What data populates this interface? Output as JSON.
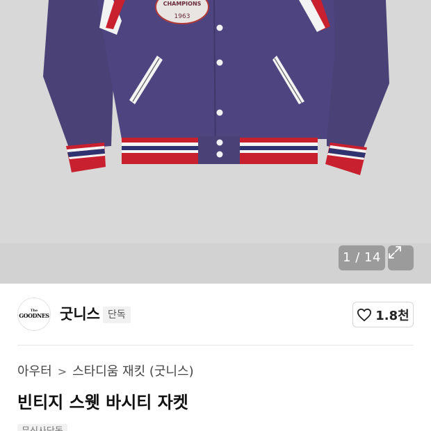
{
  "gallery": {
    "counter_text": "1 / 14",
    "patch_top_text": "CHAMPIONS",
    "patch_year_text": "1963",
    "expand_icon": "expand-icon"
  },
  "brand": {
    "logo_line1": "The",
    "logo_line2": "GOODNES",
    "name": "굿니스",
    "badge": "단독"
  },
  "like": {
    "icon": "heart-icon",
    "count": "1.8천"
  },
  "breadcrumb": {
    "category": "아우터",
    "separator": ">",
    "subcategory": "스타디움 재킷 (굿니스)"
  },
  "product": {
    "title": "빈티지 스웻 바시티 자켓",
    "tag": "무신사단독"
  },
  "colors": {
    "jacket": "#4c4379",
    "stripe_red": "#c8202f",
    "stripe_navy": "#2f3470",
    "background": "#d8d8d8"
  }
}
